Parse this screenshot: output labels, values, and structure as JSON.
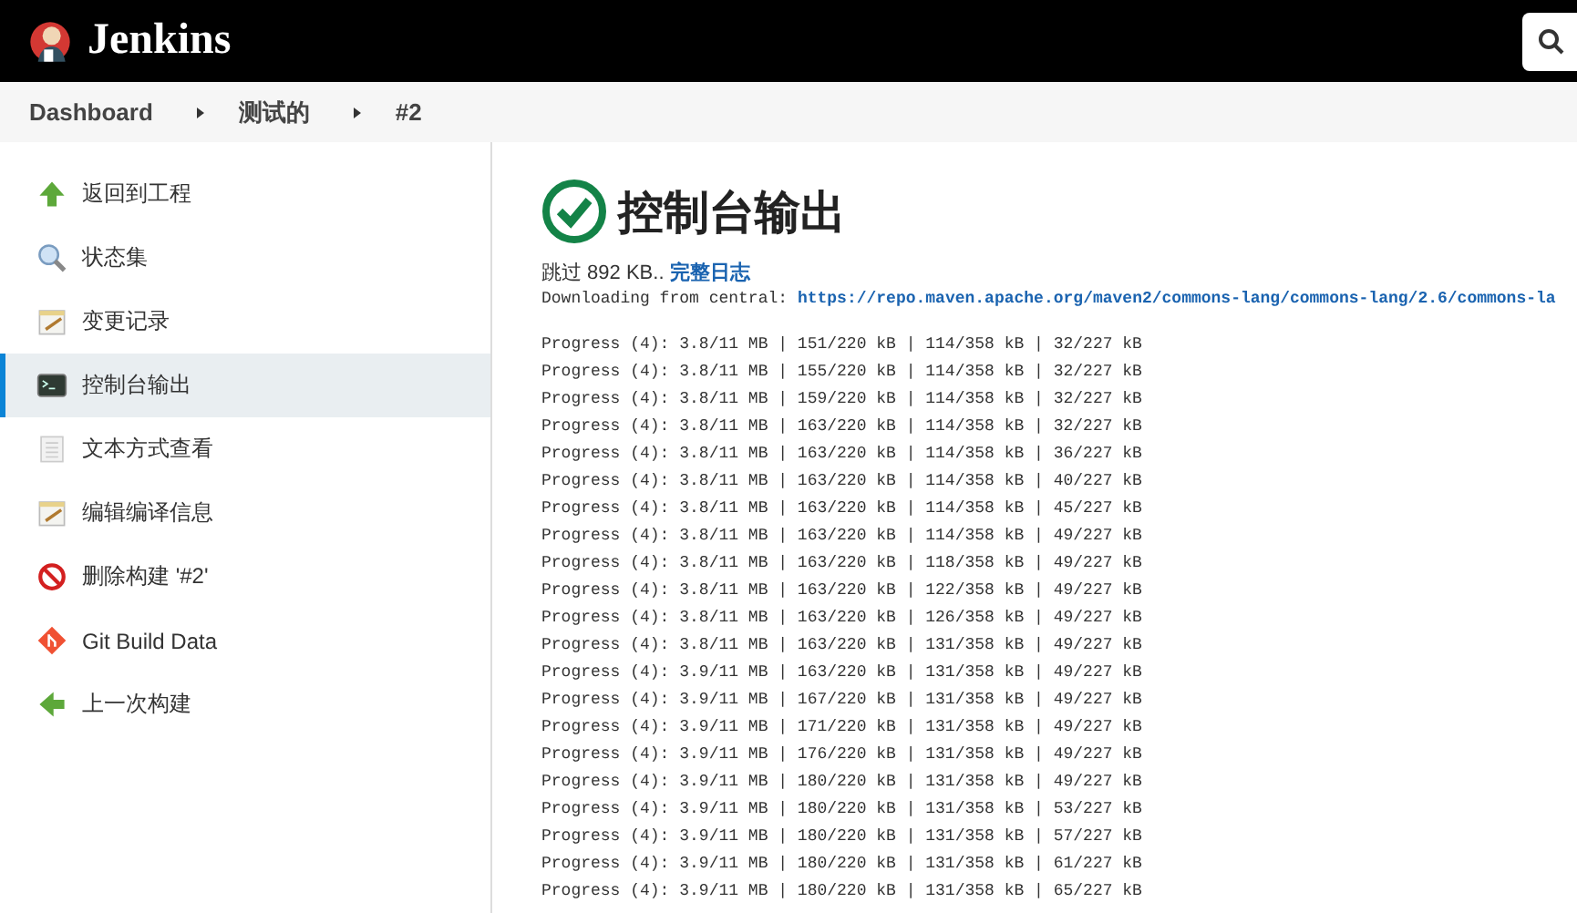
{
  "header": {
    "title": "Jenkins"
  },
  "breadcrumbs": [
    {
      "label": "Dashboard"
    },
    {
      "label": "测试的"
    },
    {
      "label": "#2"
    }
  ],
  "sidebar": {
    "items": [
      {
        "label": "返回到工程",
        "kind": "up",
        "selected": false
      },
      {
        "label": "状态集",
        "kind": "search",
        "selected": false
      },
      {
        "label": "变更记录",
        "kind": "notes",
        "selected": false
      },
      {
        "label": "控制台输出",
        "kind": "terminal",
        "selected": true
      },
      {
        "label": "文本方式查看",
        "kind": "document",
        "selected": false
      },
      {
        "label": "编辑编译信息",
        "kind": "notes",
        "selected": false
      },
      {
        "label": "删除构建 '#2'",
        "kind": "delete",
        "selected": false
      },
      {
        "label": "Git Build Data",
        "kind": "git",
        "selected": false
      },
      {
        "label": "上一次构建",
        "kind": "back",
        "selected": false
      }
    ]
  },
  "page_title": "控制台输出",
  "skipped": {
    "text": "跳过 892 KB..",
    "link": "完整日志"
  },
  "download": {
    "text": "Downloading from central: ",
    "url": "https://repo.maven.apache.org/maven2/commons-lang/commons-lang/2.6/commons-la"
  },
  "log_lines": [
    "Progress (4): 3.8/11 MB | 151/220 kB | 114/358 kB | 32/227 kB",
    "Progress (4): 3.8/11 MB | 155/220 kB | 114/358 kB | 32/227 kB",
    "Progress (4): 3.8/11 MB | 159/220 kB | 114/358 kB | 32/227 kB",
    "Progress (4): 3.8/11 MB | 163/220 kB | 114/358 kB | 32/227 kB",
    "Progress (4): 3.8/11 MB | 163/220 kB | 114/358 kB | 36/227 kB",
    "Progress (4): 3.8/11 MB | 163/220 kB | 114/358 kB | 40/227 kB",
    "Progress (4): 3.8/11 MB | 163/220 kB | 114/358 kB | 45/227 kB",
    "Progress (4): 3.8/11 MB | 163/220 kB | 114/358 kB | 49/227 kB",
    "Progress (4): 3.8/11 MB | 163/220 kB | 118/358 kB | 49/227 kB",
    "Progress (4): 3.8/11 MB | 163/220 kB | 122/358 kB | 49/227 kB",
    "Progress (4): 3.8/11 MB | 163/220 kB | 126/358 kB | 49/227 kB",
    "Progress (4): 3.8/11 MB | 163/220 kB | 131/358 kB | 49/227 kB",
    "Progress (4): 3.9/11 MB | 163/220 kB | 131/358 kB | 49/227 kB",
    "Progress (4): 3.9/11 MB | 167/220 kB | 131/358 kB | 49/227 kB",
    "Progress (4): 3.9/11 MB | 171/220 kB | 131/358 kB | 49/227 kB",
    "Progress (4): 3.9/11 MB | 176/220 kB | 131/358 kB | 49/227 kB",
    "Progress (4): 3.9/11 MB | 180/220 kB | 131/358 kB | 49/227 kB",
    "Progress (4): 3.9/11 MB | 180/220 kB | 131/358 kB | 53/227 kB",
    "Progress (4): 3.9/11 MB | 180/220 kB | 131/358 kB | 57/227 kB",
    "Progress (4): 3.9/11 MB | 180/220 kB | 131/358 kB | 61/227 kB",
    "Progress (4): 3.9/11 MB | 180/220 kB | 131/358 kB | 65/227 kB"
  ]
}
